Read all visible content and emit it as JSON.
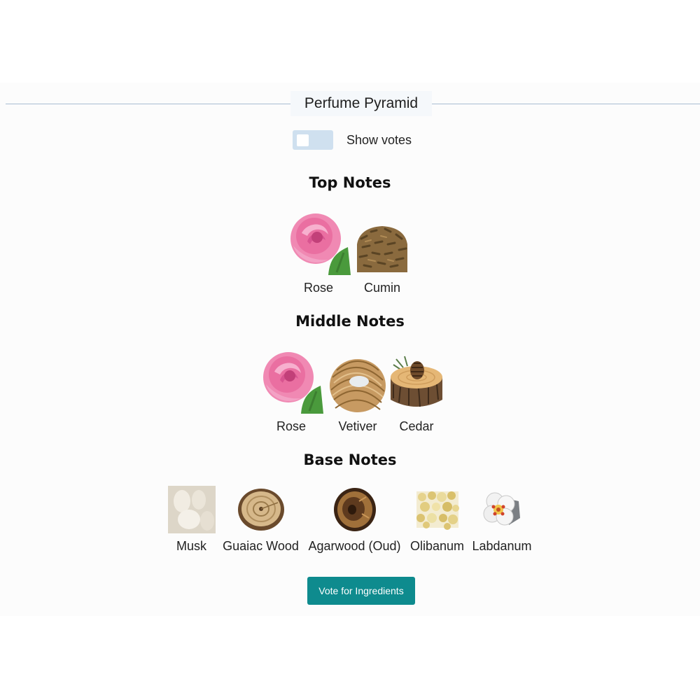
{
  "header": {
    "title": "Perfume Pyramid"
  },
  "votes_toggle": {
    "label": "Show votes",
    "checked": false
  },
  "sections": {
    "top": {
      "title": "Top Notes",
      "notes": [
        {
          "label": "Rose",
          "icon": "rose-icon"
        },
        {
          "label": "Cumin",
          "icon": "cumin-icon"
        }
      ]
    },
    "middle": {
      "title": "Middle Notes",
      "notes": [
        {
          "label": "Rose",
          "icon": "rose-icon"
        },
        {
          "label": "Vetiver",
          "icon": "vetiver-icon"
        },
        {
          "label": "Cedar",
          "icon": "cedar-icon"
        }
      ]
    },
    "base": {
      "title": "Base Notes",
      "notes": [
        {
          "label": "Musk",
          "icon": "musk-icon"
        },
        {
          "label": "Guaiac Wood",
          "icon": "guaiac-wood-icon"
        },
        {
          "label": "Agarwood (Oud)",
          "icon": "agarwood-icon"
        },
        {
          "label": "Olibanum",
          "icon": "olibanum-icon"
        },
        {
          "label": "Labdanum",
          "icon": "labdanum-icon"
        }
      ]
    }
  },
  "actions": {
    "vote_label": "Vote for Ingredients"
  },
  "colors": {
    "accent": "#0e8b8e",
    "toggle_track": "#cfe0ef",
    "divider": "#a9bdd2",
    "rose": "#e8639a",
    "wood": "#a8713d"
  }
}
